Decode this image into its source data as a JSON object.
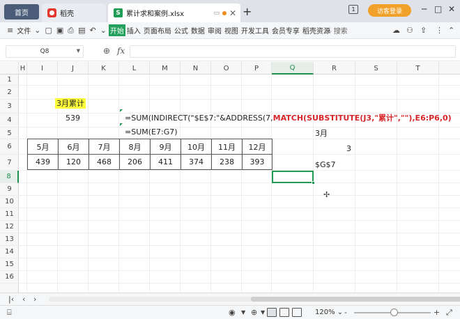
{
  "tabs": {
    "home": "首页",
    "daoke": "稻壳",
    "file": "累计求和案例.xlsx",
    "file_icon_letter": "S",
    "add": "+"
  },
  "window": {
    "badge": "1",
    "login": "访客登录",
    "minimize": "─",
    "maximize": "□",
    "close": "✕"
  },
  "ribbon": {
    "menu_icon": "≡",
    "file_menu": "文件",
    "items": [
      "开始",
      "插入",
      "页面布局",
      "公式",
      "数据",
      "审阅",
      "视图",
      "开发工具",
      "会员专享",
      "稻壳资源"
    ],
    "search_placeholder": "搜索"
  },
  "formula_bar": {
    "name_box": "Q8",
    "fx": "fx",
    "formula": ""
  },
  "columns": [
    "H",
    "I",
    "J",
    "K",
    "L",
    "M",
    "N",
    "O",
    "P",
    "Q",
    "R",
    "S",
    "T"
  ],
  "rows": [
    "1",
    "2",
    "3",
    "4",
    "5",
    "6",
    "7",
    "8",
    "9",
    "10",
    "11",
    "12",
    "13",
    "14",
    "15",
    "16"
  ],
  "cells": {
    "j3": "3月累计",
    "j4": "539",
    "f4_a": "=SUM(INDIRECT(\"$E$7:\"&ADDRESS(7,",
    "f4_b": "MATCH(SUBSTITUTE(J3,\"累计\",\"\"),E6:P6,0)",
    "f5": "=SUM(E7:G7)",
    "q6": "3月",
    "r7": "3",
    "q8": "$G$7"
  },
  "month_table": {
    "months": [
      "5月",
      "6月",
      "7月",
      "8月",
      "9月",
      "10月",
      "11月",
      "12月"
    ],
    "values": [
      "439",
      "120",
      "468",
      "206",
      "411",
      "374",
      "238",
      "393"
    ]
  },
  "status": {
    "zoom": "120%",
    "zoom_minus": "-",
    "zoom_plus": "+"
  },
  "colors": {
    "accent_green": "#1f9d55",
    "highlight_yellow": "#ffff3a",
    "formula_red": "#d7262a",
    "login_orange": "#f1a12a"
  }
}
